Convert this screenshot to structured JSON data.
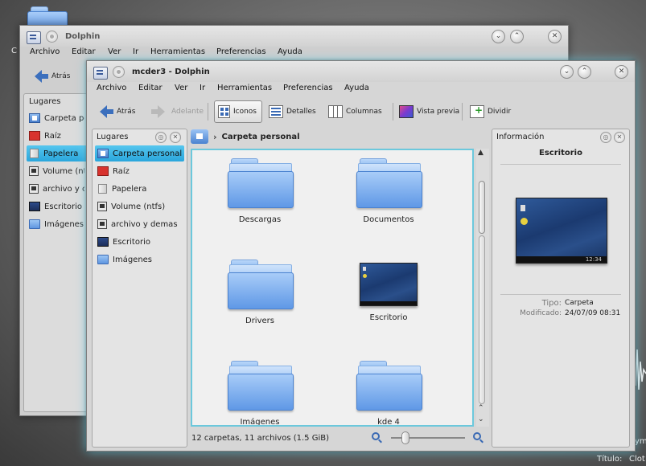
{
  "desktop": {
    "bottom_title_label": "Título:",
    "bottom_title_value": "Clot",
    "left_fragment": "C",
    "right_fragment": "ym"
  },
  "back_window": {
    "title": "Dolphin",
    "menu": [
      "Archivo",
      "Editar",
      "Ver",
      "Ir",
      "Herramientas",
      "Preferencias",
      "Ayuda"
    ],
    "back_label": "Atrás",
    "places_title": "Lugares",
    "places": [
      "Carpeta pe",
      "Raíz",
      "Papelera",
      "Volume (ntf",
      "archivo y c",
      "Escritorio",
      "Imágenes"
    ]
  },
  "window": {
    "title": "mcder3 - Dolphin",
    "menu": [
      "Archivo",
      "Editar",
      "Ver",
      "Ir",
      "Herramientas",
      "Preferencias",
      "Ayuda"
    ],
    "toolbar": {
      "back": "Atrás",
      "forward": "Adelante",
      "icons": "Iconos",
      "details": "Detalles",
      "columns": "Columnas",
      "preview": "Vista previa",
      "split": "Dividir"
    },
    "places_panel": {
      "title": "Lugares",
      "items": [
        "Carpeta personal",
        "Raíz",
        "Papelera",
        "Volume (ntfs)",
        "archivo y demas",
        "Escritorio",
        "Imágenes"
      ],
      "selected": "Carpeta personal"
    },
    "breadcrumb": {
      "current": "Carpeta personal"
    },
    "items": [
      "Descargas",
      "Documentos",
      "Drivers",
      "Escritorio",
      "Imágenes",
      "kde 4"
    ],
    "status": "12 carpetas, 11 archivos (1.5 GiB)",
    "zoom_level": 0.2,
    "info_panel": {
      "title": "Información",
      "item_name": "Escritorio",
      "thumb_clock": "12:34",
      "type_label": "Tipo:",
      "type_value": "Carpeta",
      "modified_label": "Modificado:",
      "modified_value": "24/07/09 08:31"
    }
  },
  "colors": {
    "selection": "#2aa6dc",
    "view_border": "#6cc8dc",
    "folder_blue": "#5f98e6"
  }
}
